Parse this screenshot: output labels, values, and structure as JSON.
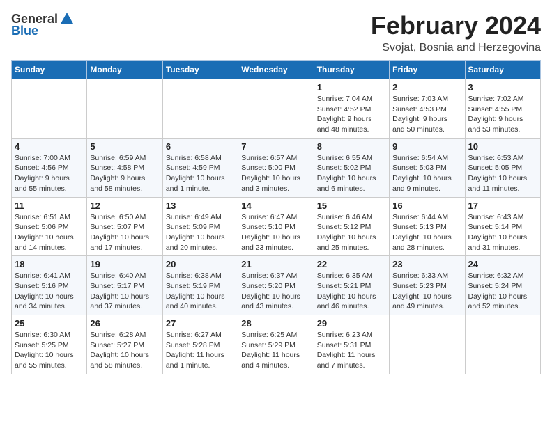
{
  "header": {
    "logo_general": "General",
    "logo_blue": "Blue",
    "month": "February 2024",
    "location": "Svojat, Bosnia and Herzegovina"
  },
  "weekdays": [
    "Sunday",
    "Monday",
    "Tuesday",
    "Wednesday",
    "Thursday",
    "Friday",
    "Saturday"
  ],
  "weeks": [
    [
      {
        "day": "",
        "info": ""
      },
      {
        "day": "",
        "info": ""
      },
      {
        "day": "",
        "info": ""
      },
      {
        "day": "",
        "info": ""
      },
      {
        "day": "1",
        "info": "Sunrise: 7:04 AM\nSunset: 4:52 PM\nDaylight: 9 hours\nand 48 minutes."
      },
      {
        "day": "2",
        "info": "Sunrise: 7:03 AM\nSunset: 4:53 PM\nDaylight: 9 hours\nand 50 minutes."
      },
      {
        "day": "3",
        "info": "Sunrise: 7:02 AM\nSunset: 4:55 PM\nDaylight: 9 hours\nand 53 minutes."
      }
    ],
    [
      {
        "day": "4",
        "info": "Sunrise: 7:00 AM\nSunset: 4:56 PM\nDaylight: 9 hours\nand 55 minutes."
      },
      {
        "day": "5",
        "info": "Sunrise: 6:59 AM\nSunset: 4:58 PM\nDaylight: 9 hours\nand 58 minutes."
      },
      {
        "day": "6",
        "info": "Sunrise: 6:58 AM\nSunset: 4:59 PM\nDaylight: 10 hours\nand 1 minute."
      },
      {
        "day": "7",
        "info": "Sunrise: 6:57 AM\nSunset: 5:00 PM\nDaylight: 10 hours\nand 3 minutes."
      },
      {
        "day": "8",
        "info": "Sunrise: 6:55 AM\nSunset: 5:02 PM\nDaylight: 10 hours\nand 6 minutes."
      },
      {
        "day": "9",
        "info": "Sunrise: 6:54 AM\nSunset: 5:03 PM\nDaylight: 10 hours\nand 9 minutes."
      },
      {
        "day": "10",
        "info": "Sunrise: 6:53 AM\nSunset: 5:05 PM\nDaylight: 10 hours\nand 11 minutes."
      }
    ],
    [
      {
        "day": "11",
        "info": "Sunrise: 6:51 AM\nSunset: 5:06 PM\nDaylight: 10 hours\nand 14 minutes."
      },
      {
        "day": "12",
        "info": "Sunrise: 6:50 AM\nSunset: 5:07 PM\nDaylight: 10 hours\nand 17 minutes."
      },
      {
        "day": "13",
        "info": "Sunrise: 6:49 AM\nSunset: 5:09 PM\nDaylight: 10 hours\nand 20 minutes."
      },
      {
        "day": "14",
        "info": "Sunrise: 6:47 AM\nSunset: 5:10 PM\nDaylight: 10 hours\nand 23 minutes."
      },
      {
        "day": "15",
        "info": "Sunrise: 6:46 AM\nSunset: 5:12 PM\nDaylight: 10 hours\nand 25 minutes."
      },
      {
        "day": "16",
        "info": "Sunrise: 6:44 AM\nSunset: 5:13 PM\nDaylight: 10 hours\nand 28 minutes."
      },
      {
        "day": "17",
        "info": "Sunrise: 6:43 AM\nSunset: 5:14 PM\nDaylight: 10 hours\nand 31 minutes."
      }
    ],
    [
      {
        "day": "18",
        "info": "Sunrise: 6:41 AM\nSunset: 5:16 PM\nDaylight: 10 hours\nand 34 minutes."
      },
      {
        "day": "19",
        "info": "Sunrise: 6:40 AM\nSunset: 5:17 PM\nDaylight: 10 hours\nand 37 minutes."
      },
      {
        "day": "20",
        "info": "Sunrise: 6:38 AM\nSunset: 5:19 PM\nDaylight: 10 hours\nand 40 minutes."
      },
      {
        "day": "21",
        "info": "Sunrise: 6:37 AM\nSunset: 5:20 PM\nDaylight: 10 hours\nand 43 minutes."
      },
      {
        "day": "22",
        "info": "Sunrise: 6:35 AM\nSunset: 5:21 PM\nDaylight: 10 hours\nand 46 minutes."
      },
      {
        "day": "23",
        "info": "Sunrise: 6:33 AM\nSunset: 5:23 PM\nDaylight: 10 hours\nand 49 minutes."
      },
      {
        "day": "24",
        "info": "Sunrise: 6:32 AM\nSunset: 5:24 PM\nDaylight: 10 hours\nand 52 minutes."
      }
    ],
    [
      {
        "day": "25",
        "info": "Sunrise: 6:30 AM\nSunset: 5:25 PM\nDaylight: 10 hours\nand 55 minutes."
      },
      {
        "day": "26",
        "info": "Sunrise: 6:28 AM\nSunset: 5:27 PM\nDaylight: 10 hours\nand 58 minutes."
      },
      {
        "day": "27",
        "info": "Sunrise: 6:27 AM\nSunset: 5:28 PM\nDaylight: 11 hours\nand 1 minute."
      },
      {
        "day": "28",
        "info": "Sunrise: 6:25 AM\nSunset: 5:29 PM\nDaylight: 11 hours\nand 4 minutes."
      },
      {
        "day": "29",
        "info": "Sunrise: 6:23 AM\nSunset: 5:31 PM\nDaylight: 11 hours\nand 7 minutes."
      },
      {
        "day": "",
        "info": ""
      },
      {
        "day": "",
        "info": ""
      }
    ]
  ]
}
